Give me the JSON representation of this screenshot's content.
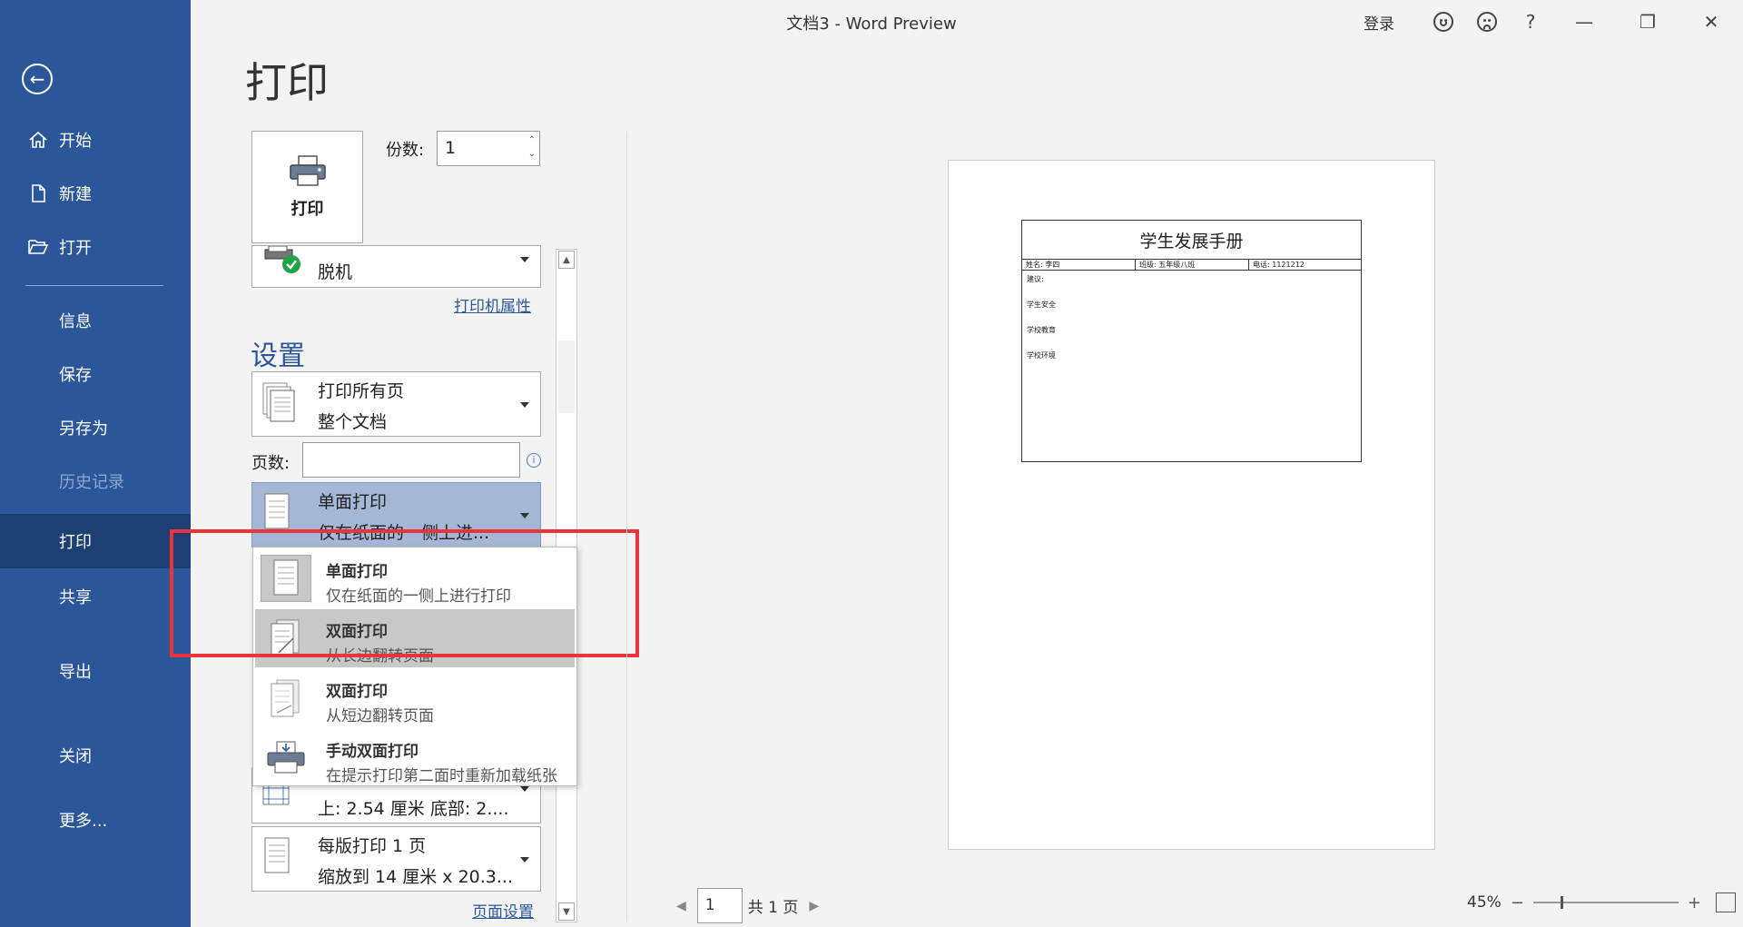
{
  "window": {
    "title": "文档3  -  Word Preview",
    "signin": "登录",
    "help": "?",
    "minimize": "—",
    "restore": "❐",
    "close": "✕"
  },
  "sidebar": {
    "items": [
      {
        "label": "开始",
        "icon": "home-icon"
      },
      {
        "label": "新建",
        "icon": "new-doc-icon"
      },
      {
        "label": "打开",
        "icon": "folder-open-icon"
      },
      {
        "label": "信息"
      },
      {
        "label": "保存"
      },
      {
        "label": "另存为"
      },
      {
        "label": "历史记录"
      },
      {
        "label": "打印"
      },
      {
        "label": "共享"
      },
      {
        "label": "导出"
      },
      {
        "label": "关闭"
      },
      {
        "label": "更多..."
      }
    ]
  },
  "print": {
    "title": "打印",
    "print_button": "打印",
    "copies_label": "份数:",
    "copies_value": "1",
    "printer_status": "脱机",
    "printer_properties": "打印机属性",
    "settings_heading": "设置",
    "range_line1": "打印所有页",
    "range_line2": "整个文档",
    "pages_label": "页数:",
    "pages_value": "",
    "sided_line1": "单面打印",
    "sided_line2": "仅在纸面的一侧上进...",
    "margins_line2": "上: 2.54 厘米 底部: 2....",
    "perpage_line1": "每版打印 1 页",
    "perpage_line2": "缩放到 14 厘米 x 20.3...",
    "page_setup": "页面设置"
  },
  "dropdown": {
    "items": [
      {
        "title": "单面打印",
        "desc": "仅在纸面的一侧上进行打印"
      },
      {
        "title": "双面打印",
        "desc": "从长边翻转页面"
      },
      {
        "title": "双面打印",
        "desc": "从短边翻转页面"
      },
      {
        "title": "手动双面打印",
        "desc": "在提示打印第二面时重新加载纸张"
      }
    ]
  },
  "preview": {
    "doc_title": "学生发展手册",
    "name": "姓名: 李四",
    "class": "班级: 五年级八班",
    "phone": "电话: 1121212",
    "line1": "建议:",
    "line2": "学生安全",
    "line3": "学校教育",
    "line4": "学校环境"
  },
  "footer": {
    "current_page": "1",
    "total_pages": "共 1 页",
    "zoom": "45%"
  },
  "colors": {
    "sidebar": "#2b579a",
    "accent": "#2b579a",
    "highlight": "#e8343a"
  }
}
